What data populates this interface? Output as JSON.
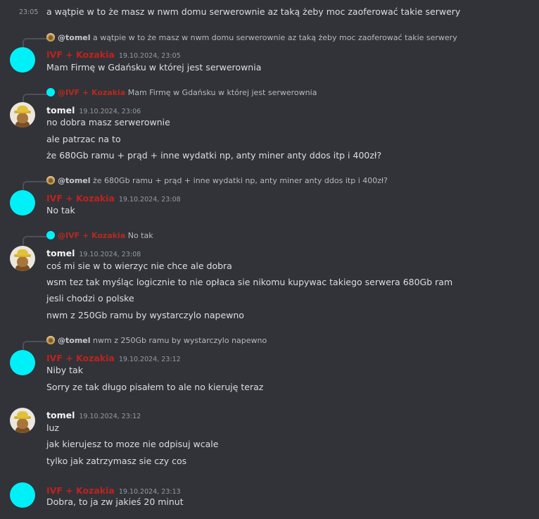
{
  "messages": {
    "m0": {
      "time": "23:05",
      "text": "a wątpie w to że masz w nwm domu serwerownie az taką żeby moc zaoferować takie serwery"
    },
    "m1": {
      "reply_name": "@tomel",
      "reply_text": "a wątpie w to że masz w nwm domu serwerownie az taką żeby moc zaoferować takie serwery",
      "author": "IVF + Kozakia",
      "timestamp": "19.10.2024, 23:05",
      "lines": [
        "Mam Firmę w Gdańsku w której jest serwerownia"
      ]
    },
    "m2": {
      "reply_name": "@IVF + Kozakia",
      "reply_text": "Mam Firmę w Gdańsku w której jest serwerownia",
      "author": "tomel",
      "timestamp": "19.10.2024, 23:06",
      "lines": [
        "no dobra masz serwerownie",
        "ale patrzac na to",
        "że 680Gb ramu + prąd + inne wydatki np, anty miner anty ddos itp i 400zł?"
      ]
    },
    "m3": {
      "reply_name": "@tomel",
      "reply_text": "że 680Gb ramu + prąd + inne wydatki np, anty miner anty ddos itp i 400zł?",
      "author": "IVF + Kozakia",
      "timestamp": "19.10.2024, 23:08",
      "lines": [
        "No tak"
      ]
    },
    "m4": {
      "reply_name": "@IVF + Kozakia",
      "reply_text": "No tak",
      "author": "tomel",
      "timestamp": "19.10.2024, 23:08",
      "lines": [
        "coś mi sie w to wierzyc nie chce ale dobra",
        "wsm tez tak myśląc logicznie to nie opłaca sie nikomu kupywac takiego serwera 680Gb ram",
        "jesli chodzi o polske",
        "nwm z 250Gb ramu by wystarczylo napewno"
      ]
    },
    "m5": {
      "reply_name": "@tomel",
      "reply_text": "nwm z 250Gb ramu by wystarczylo napewno",
      "author": "IVF + Kozakia",
      "timestamp": "19.10.2024, 23:12",
      "lines": [
        "Niby tak",
        "Sorry ze tak długo pisałem to ale no kieruję teraz"
      ]
    },
    "m6": {
      "author": "tomel",
      "timestamp": "19.10.2024, 23:12",
      "lines": [
        "luz",
        "jak kierujesz to moze nie odpisuj wcale",
        "tylko jak zatrzymasz sie czy cos"
      ]
    },
    "m7": {
      "author": "IVF + Kozakia",
      "timestamp": "19.10.2024, 23:13",
      "lines": [
        "Dobra, to ja zw jakieś 20 minut"
      ]
    }
  },
  "colors": {
    "background": "#313338",
    "accent_cyan": "#00f0f8",
    "author_red": "#c0221e"
  }
}
